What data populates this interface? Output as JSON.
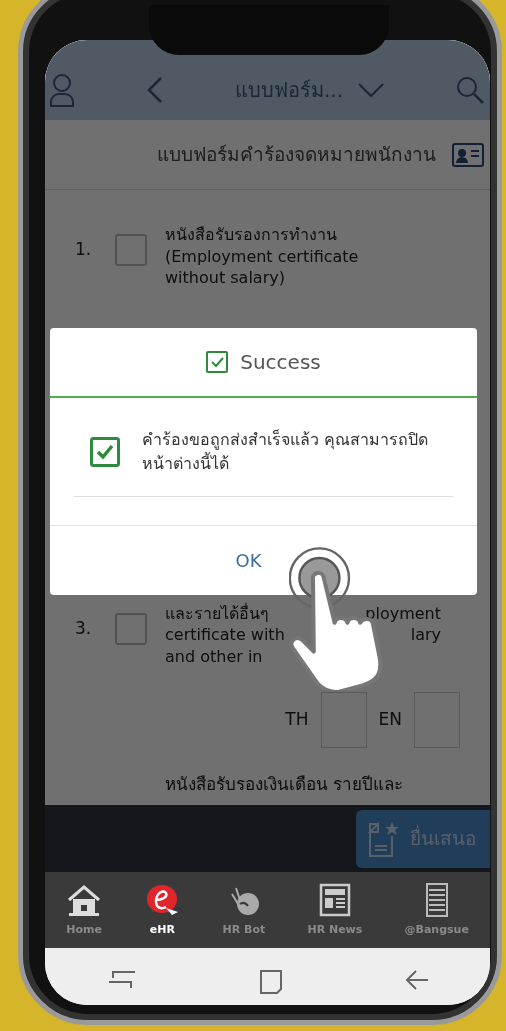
{
  "app_bar": {
    "title": "แบบฟอร์ม..."
  },
  "page_title": "แบบฟอร์มคำร้องจดหมายพนักงาน",
  "form_items": [
    {
      "number": "1.",
      "checked": false,
      "lines": [
        {
          "text": "หนังสือรับรองการทำงาน"
        },
        {
          "text": "(Employment certificate"
        },
        {
          "text": "without salary)"
        }
      ]
    },
    {
      "number": "3.",
      "checked": false,
      "lines": [
        {
          "text": "และรายได้อื่นๆ",
          "text_right": "ployment"
        },
        {
          "text": "certificate with",
          "text_right": "lary"
        },
        {
          "text": "and other in"
        }
      ],
      "languages": [
        {
          "label": "TH",
          "checked": false
        },
        {
          "label": "EN",
          "checked": false
        }
      ]
    }
  ],
  "next_item_text": "หนังสือรับรองเงินเดือน รายปีและ",
  "submit_button": {
    "label": "ยื่นเสนอ"
  },
  "dialog": {
    "title": "Success",
    "checked": true,
    "message": "คำร้องขอถูกส่งสำเร็จแล้ว คุณสามารถปิดหน้าต่างนี้ได้",
    "button": "OK"
  },
  "tabs": [
    {
      "kind": "home",
      "label": "Home",
      "selected": false
    },
    {
      "kind": "ehr",
      "label": "eHR",
      "selected": true
    },
    {
      "kind": "bot",
      "label": "HR Bot",
      "selected": false
    },
    {
      "kind": "news",
      "label": "HR News",
      "selected": false
    },
    {
      "kind": "list",
      "label": "@Bangsue",
      "selected": false
    }
  ]
}
